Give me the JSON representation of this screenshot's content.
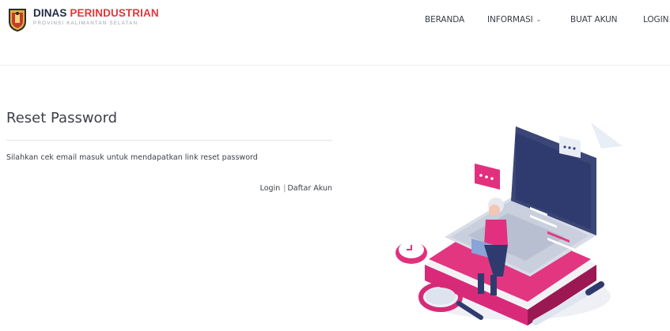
{
  "header": {
    "brand_part1": "DINAS ",
    "brand_part2": "PERINDUSTRIAN",
    "brand_sub": "PROVINSI KALIMANTAN SELATAN",
    "nav": [
      {
        "label": "BERANDA"
      },
      {
        "label": "INFORMASI",
        "has_dropdown": true
      },
      {
        "label": "BUAT AKUN"
      },
      {
        "label": "LOGIN"
      }
    ]
  },
  "main": {
    "title": "Reset Password",
    "message": "Silahkan cek email masuk untuk mendapatkan link reset password",
    "login_link": "Login",
    "separator": "|",
    "register_link": "Daftar Akun"
  },
  "colors": {
    "brand_dark": "#1f2a44",
    "brand_red": "#e3373a",
    "accent_pink": "#e2307f",
    "laptop_navy": "#2f3b6e"
  },
  "icons": {
    "logo": "shield-emblem",
    "dropdown": "chevron-down-icon"
  }
}
